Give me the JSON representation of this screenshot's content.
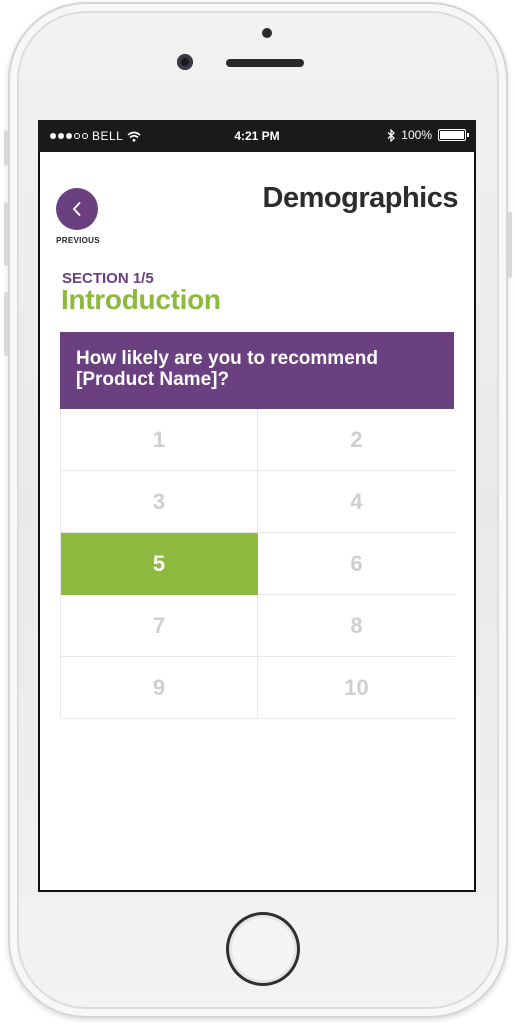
{
  "status_bar": {
    "carrier": "BELL",
    "time": "4:21 PM",
    "battery": "100%",
    "signal_dots_filled": 3,
    "signal_dots_total": 5
  },
  "header": {
    "back_label": "PREVIOUS",
    "title": "Demographics"
  },
  "section": {
    "label": "SECTION 1/5",
    "title": "Introduction"
  },
  "question": {
    "text": "How likely are you to recommend [Product Name]?"
  },
  "rating": {
    "options": [
      "1",
      "2",
      "3",
      "4",
      "5",
      "6",
      "7",
      "8",
      "9",
      "10"
    ],
    "selected": "5"
  },
  "colors": {
    "purple": "#6a4081",
    "green": "#8dba3e",
    "unselected_text": "#cfcfcf"
  }
}
